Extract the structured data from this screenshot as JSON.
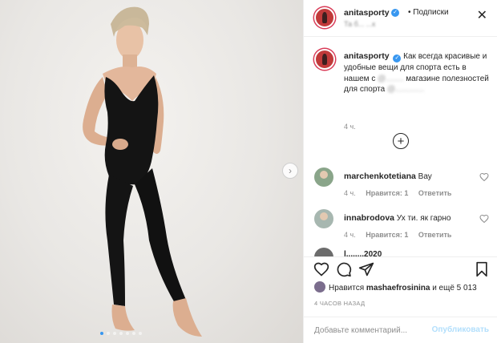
{
  "header": {
    "username": "anitasporty",
    "follow_label": "• Подписки",
    "location": "Та б... ...к",
    "close_icon": "close-icon"
  },
  "caption": {
    "username": "anitasporty",
    "text_part1": "Как всегда красивые и удобные вещи для спорта есть в нашем с",
    "text_blur1": "@........",
    "text_part2": "магазине полезностей для спорта",
    "text_blur2": "@.............",
    "time": "4 ч."
  },
  "comments": [
    {
      "username": "marchenkotetiana",
      "text": "Вау",
      "time": "4 ч.",
      "likes": "Нравится: 1",
      "reply": "Ответить"
    },
    {
      "username": "innabrodova",
      "text": "Ух ти. як гарно",
      "time": "4 ч.",
      "likes": "Нравится: 1",
      "reply": "Ответить"
    }
  ],
  "faded_comment": {
    "username": "l........2020"
  },
  "likes_line": {
    "prefix": "Нравится",
    "user": "mashaefrosinina",
    "suffix": "и ещё 5 013"
  },
  "timestamp": "4 ЧАСОВ НАЗАД",
  "add_comment": {
    "placeholder": "Добавьте комментарий...",
    "publish_label": "Опубликовать"
  },
  "carousel": {
    "total": 7,
    "active_index": 0
  },
  "colors": {
    "link_blue": "#3897f0",
    "publish_disabled": "#b2dffc",
    "muted": "#8e8e8e"
  }
}
